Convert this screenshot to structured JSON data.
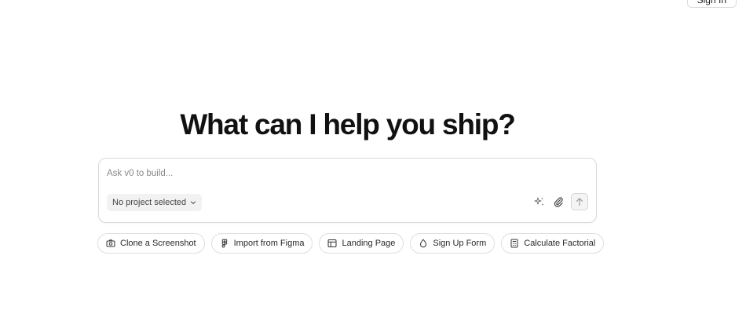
{
  "header": {
    "signin_label": "Sign In"
  },
  "hero": {
    "headline": "What can I help you ship?"
  },
  "composer": {
    "placeholder": "Ask v0 to build...",
    "project_select_label": "No project selected",
    "icons": [
      "sparkles-icon",
      "paperclip-icon",
      "arrow-up-icon"
    ]
  },
  "suggestions": [
    {
      "label": "Clone a Screenshot",
      "icon": "camera-icon"
    },
    {
      "label": "Import from Figma",
      "icon": "figma-icon"
    },
    {
      "label": "Landing Page",
      "icon": "layout-icon"
    },
    {
      "label": "Sign Up Form",
      "icon": "droplet-icon"
    },
    {
      "label": "Calculate Factorial",
      "icon": "calculator-icon"
    }
  ]
}
